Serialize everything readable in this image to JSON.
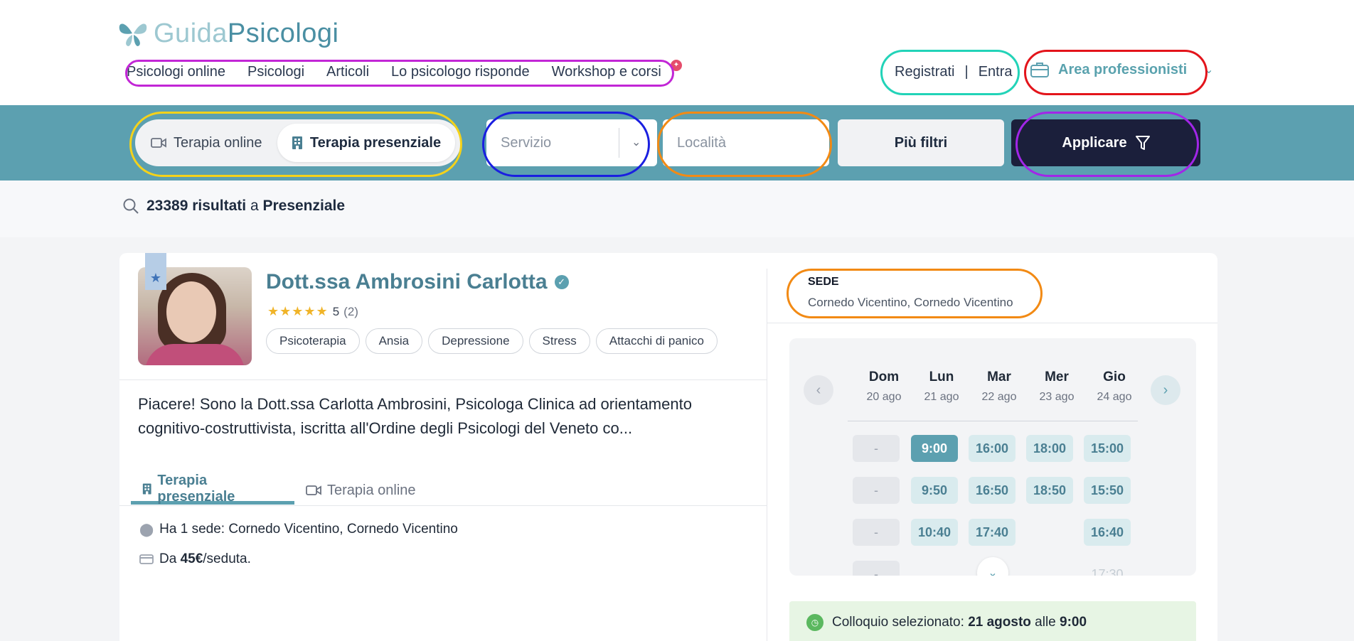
{
  "header": {
    "logo": {
      "part1": "Guida",
      "part2": "Psicologi"
    },
    "nav": [
      "Psicologi online",
      "Psicologi",
      "Articoli",
      "Lo psicologo risponde",
      "Workshop e corsi"
    ],
    "auth": {
      "register": "Registrati",
      "separator": "|",
      "login": "Entra"
    },
    "pro_area": "Area professionisti"
  },
  "search": {
    "mode_online": "Terapia online",
    "mode_presenziale": "Terapia presenziale",
    "service_placeholder": "Servizio",
    "location_placeholder": "Località",
    "more_filters": "Più filtri",
    "apply": "Applicare"
  },
  "results": {
    "count": "23389 risultati",
    "preposition": "a",
    "mode": "Presenziale"
  },
  "card": {
    "name": "Dott.ssa Ambrosini Carlotta",
    "rating": {
      "stars": "★★★★★",
      "value": "5",
      "count": "(2)"
    },
    "tags": [
      "Psicoterapia",
      "Ansia",
      "Depressione",
      "Stress",
      "Attacchi di panico"
    ],
    "bio": "Piacere! Sono la Dott.ssa Carlotta Ambrosini, Psicologa Clinica ad orientamento cognitivo-costruttivista, iscritta all'Ordine degli Psicologi del Veneto co...",
    "tabs": {
      "presenziale": "Terapia presenziale",
      "online": "Terapia online"
    },
    "location": "Ha 1 sede: Cornedo Vicentino, Cornedo Vicentino",
    "price": {
      "prefix": "Da",
      "amount": "45€",
      "suffix": "/seduta."
    }
  },
  "sede": {
    "label": "SEDE",
    "value": "Cornedo Vicentino, Cornedo Vicentino"
  },
  "calendar": {
    "days": [
      {
        "name": "Dom",
        "date": "20 ago"
      },
      {
        "name": "Lun",
        "date": "21 ago"
      },
      {
        "name": "Mar",
        "date": "22 ago"
      },
      {
        "name": "Mer",
        "date": "23 ago"
      },
      {
        "name": "Gio",
        "date": "24 ago"
      }
    ],
    "slots": {
      "dom": [
        "-",
        "-",
        "-",
        "-"
      ],
      "lun": [
        "9:00",
        "9:50",
        "10:40"
      ],
      "mar": [
        "16:00",
        "16:50",
        "17:40"
      ],
      "mer": [
        "18:00",
        "18:50"
      ],
      "gio": [
        "15:00",
        "15:50",
        "16:40",
        "17:30"
      ]
    },
    "selected_slot": "9:00"
  },
  "selection": {
    "prefix": "Colloquio selezionato:",
    "date": "21 agosto",
    "mid": "alle",
    "time": "9:00"
  },
  "colors": {
    "teal": "#5ca0b0",
    "navy": "#1b1f3b",
    "star": "#f0b429",
    "selected_green_bg": "#e7f5e4"
  },
  "annotations": {
    "colors": [
      "#c226d6",
      "#22d3b8",
      "#e3141b",
      "#f5d21a",
      "#1a1fe0",
      "#f28a14",
      "#a226e8"
    ]
  }
}
